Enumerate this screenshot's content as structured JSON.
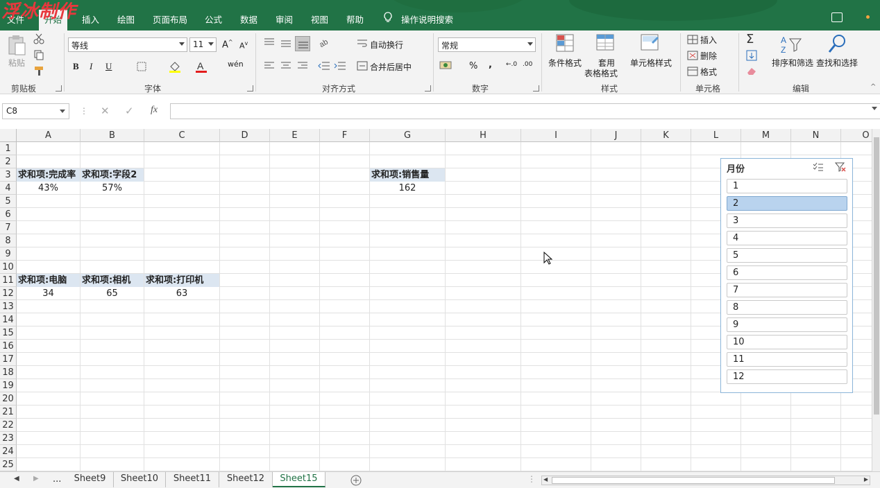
{
  "watermark": "浮冰制作",
  "tabs": {
    "file": "文件",
    "home": "开始",
    "insert": "插入",
    "draw": "绘图",
    "layout": "页面布局",
    "formulas": "公式",
    "data": "数据",
    "review": "审阅",
    "view": "视图",
    "help": "帮助",
    "tellme": "操作说明搜索"
  },
  "ribbon": {
    "paste": "粘贴",
    "clipboard": "剪贴板",
    "font_name": "等线",
    "font_size": "11",
    "font_group": "字体",
    "bold": "B",
    "italic": "I",
    "underline": "U",
    "wrap_text": "自动换行",
    "merge_center": "合并后居中",
    "alignment_group": "对齐方式",
    "number_format": "常规",
    "number_group": "数字",
    "conditional_format": "条件格式",
    "format_as_table_1": "套用",
    "format_as_table_2": "表格格式",
    "cell_styles": "单元格样式",
    "styles_group": "样式",
    "insert": "插入",
    "delete": "删除",
    "format": "格式",
    "cells_group": "单元格",
    "sort_filter": "排序和筛选",
    "find_select": "查找和选择",
    "editing_group": "编辑",
    "percent": "%",
    "comma": ","
  },
  "formula_bar": {
    "name_box": "C8",
    "fx": "fx",
    "content": ""
  },
  "columns": [
    "A",
    "B",
    "C",
    "D",
    "E",
    "F",
    "G",
    "H",
    "I",
    "J",
    "K",
    "L",
    "M",
    "N",
    "O"
  ],
  "rows": [
    "1",
    "2",
    "3",
    "4",
    "5",
    "6",
    "7",
    "8",
    "9",
    "10",
    "11",
    "12",
    "13",
    "14",
    "15",
    "16",
    "17",
    "18",
    "19",
    "20",
    "21",
    "22",
    "23",
    "24",
    "25"
  ],
  "cells": {
    "A3": "求和项:完成率",
    "B3": "求和项:字段2",
    "A4": "43%",
    "B4": "57%",
    "G3": "求和项:销售量",
    "G4": "162",
    "A11": "求和项:电脑",
    "B11": "求和项:相机",
    "C11": "求和项:打印机",
    "A12": "34",
    "B12": "65",
    "C12": "63"
  },
  "slicer": {
    "title": "月份",
    "items": [
      "1",
      "2",
      "3",
      "4",
      "5",
      "6",
      "7",
      "8",
      "9",
      "10",
      "11",
      "12"
    ],
    "selected": "2"
  },
  "sheets": {
    "ellipsis": "...",
    "tabs": [
      "Sheet9",
      "Sheet10",
      "Sheet11",
      "Sheet12",
      "Sheet15"
    ],
    "active": "Sheet15"
  },
  "colors": {
    "accent": "#217346",
    "header_fill": "#dce6f1",
    "slicer_selected": "#b9d3ee"
  }
}
